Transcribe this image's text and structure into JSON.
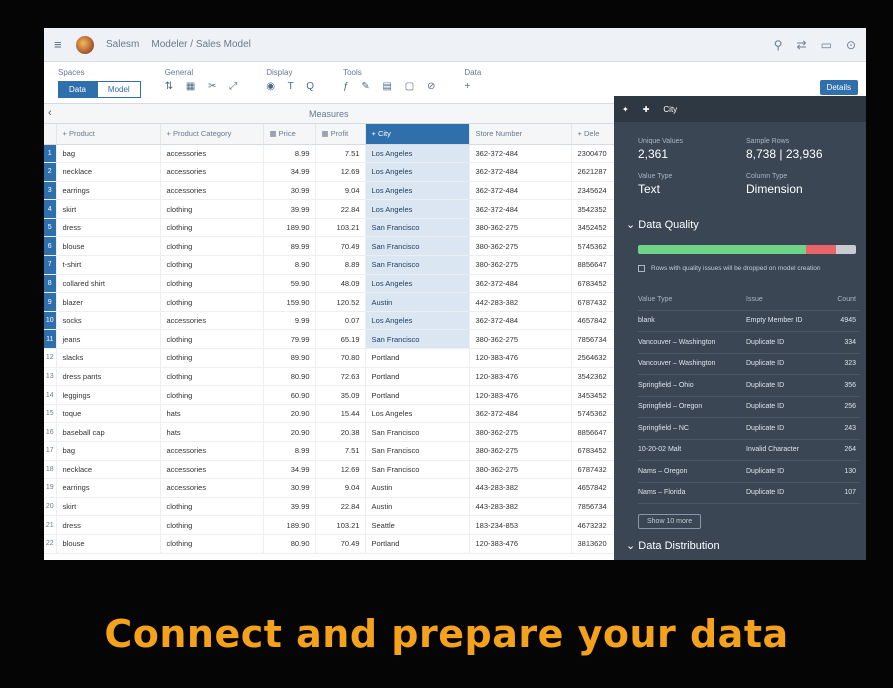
{
  "shell": {
    "menu_icon": "hamburger-icon",
    "app_name": "Salesm",
    "breadcrumb": "Modeler / Sales Model",
    "icons": [
      "search-icon",
      "share-icon",
      "chat-icon",
      "help-icon"
    ]
  },
  "toolbar": {
    "groups": [
      {
        "label": "Spaces",
        "items": [
          "Data",
          "Model"
        ]
      },
      {
        "label": "General",
        "icons": "⇅ ▦ ✂ ⤢"
      },
      {
        "label": "Display",
        "icons": "◉ T Q"
      },
      {
        "label": "Tools",
        "icons": "ƒ ✎ ▤ ▢ ⊘"
      },
      {
        "label": "Data",
        "icons": "+"
      }
    ],
    "details_label": "Details"
  },
  "measures_label": "Measures",
  "grid": {
    "columns": [
      "+ Product",
      "+ Product Category",
      "▦ Price",
      "▦ Profit",
      "+ City",
      "Store Number",
      "+ Dele"
    ],
    "rows": [
      {
        "i": "1",
        "c": [
          "bag",
          "accessories",
          "8.99",
          "7.51",
          "Los Angeles",
          "362-372-484",
          "2300470"
        ]
      },
      {
        "i": "2",
        "c": [
          "necklace",
          "accessories",
          "34.99",
          "12.69",
          "Los Angeles",
          "362-372-484",
          "2621287"
        ]
      },
      {
        "i": "3",
        "c": [
          "earrings",
          "accessories",
          "30.99",
          "9.04",
          "Los Angeles",
          "362-372-484",
          "2345624"
        ]
      },
      {
        "i": "4",
        "c": [
          "skirt",
          "clothing",
          "39.99",
          "22.84",
          "Los Angeles",
          "362-372-484",
          "3542352"
        ]
      },
      {
        "i": "5",
        "c": [
          "dress",
          "clothing",
          "189.90",
          "103.21",
          "San Francisco",
          "380-362-275",
          "3452452"
        ]
      },
      {
        "i": "6",
        "c": [
          "blouse",
          "clothing",
          "89.99",
          "70.49",
          "San Francisco",
          "380-362-275",
          "5745362"
        ]
      },
      {
        "i": "7",
        "c": [
          "t-shirt",
          "clothing",
          "8.90",
          "8.89",
          "San Francisco",
          "380-362-275",
          "8856647"
        ]
      },
      {
        "i": "8",
        "c": [
          "collared shirt",
          "clothing",
          "59.90",
          "48.09",
          "Los Angeles",
          "362-372-484",
          "6783452"
        ]
      },
      {
        "i": "9",
        "c": [
          "blazer",
          "clothing",
          "159.90",
          "120.52",
          "Austin",
          "442-283-382",
          "6787432"
        ]
      },
      {
        "i": "10",
        "c": [
          "socks",
          "accessories",
          "9.99",
          "0.07",
          "Los Angeles",
          "362-372-484",
          "4657842"
        ]
      },
      {
        "i": "11",
        "c": [
          "jeans",
          "clothing",
          "79.99",
          "65.19",
          "San Francisco",
          "380-362-275",
          "7856734"
        ]
      },
      {
        "i": "12",
        "c": [
          "slacks",
          "clothing",
          "89.90",
          "70.80",
          "Portland",
          "120-383-476",
          "2564632"
        ]
      },
      {
        "i": "13",
        "c": [
          "dress pants",
          "clothing",
          "80.90",
          "72.63",
          "Portland",
          "120-383-476",
          "3542362"
        ]
      },
      {
        "i": "14",
        "c": [
          "leggings",
          "clothing",
          "60.90",
          "35.09",
          "Portland",
          "120-383-476",
          "3453452"
        ]
      },
      {
        "i": "15",
        "c": [
          "toque",
          "hats",
          "20.90",
          "15.44",
          "Los Angeles",
          "362-372-484",
          "5745362"
        ]
      },
      {
        "i": "16",
        "c": [
          "baseball cap",
          "hats",
          "20.90",
          "20.38",
          "San Francisco",
          "380-362-275",
          "8856647"
        ]
      },
      {
        "i": "17",
        "c": [
          "bag",
          "accessories",
          "8.99",
          "7.51",
          "San Francisco",
          "380-362-275",
          "6783452"
        ]
      },
      {
        "i": "18",
        "c": [
          "necklace",
          "accessories",
          "34.99",
          "12.69",
          "San Francisco",
          "380-362-275",
          "6787432"
        ]
      },
      {
        "i": "19",
        "c": [
          "earrings",
          "accessories",
          "30.99",
          "9.04",
          "Austin",
          "443-283-382",
          "4657842"
        ]
      },
      {
        "i": "20",
        "c": [
          "skirt",
          "clothing",
          "39.99",
          "22.84",
          "Austin",
          "443-283-382",
          "7856734"
        ]
      },
      {
        "i": "21",
        "c": [
          "dress",
          "clothing",
          "189.90",
          "103.21",
          "Seattle",
          "183-234-853",
          "4673232"
        ]
      },
      {
        "i": "22",
        "c": [
          "blouse",
          "clothing",
          "80.90",
          "70.49",
          "Portland",
          "120-383-476",
          "3813620"
        ]
      }
    ]
  },
  "panel": {
    "title": "City",
    "stats": [
      {
        "k": "Unique Values",
        "v": "2,361"
      },
      {
        "k": "Sample Rows",
        "v": "8,738 | 23,936"
      },
      {
        "k": "Value Type",
        "v": "Text"
      },
      {
        "k": "Column Type",
        "v": "Dimension"
      }
    ],
    "quality_title": "Data Quality",
    "quality_bar": {
      "good": 0.77,
      "bad": 0.14,
      "other": 0.09,
      "colors": {
        "good": "#6fd38a",
        "bad": "#e9636b",
        "other": "#c8ccd1"
      }
    },
    "note": "Rows with quality issues will be dropped on model creation",
    "table_header": [
      "Value Type",
      "Issue",
      "Count"
    ],
    "table_rows": [
      [
        "blank",
        "Empty Member ID",
        "4945"
      ],
      [
        "Vancouver – Washington",
        "Duplicate ID",
        "334"
      ],
      [
        "Vancouver – Washington",
        "Duplicate ID",
        "323"
      ],
      [
        "Springfield – Ohio",
        "Duplicate ID",
        "356"
      ],
      [
        "Springfield – Oregon",
        "Duplicate ID",
        "256"
      ],
      [
        "Springfield – NC",
        "Duplicate ID",
        "243"
      ],
      [
        "10-20-02 Malt",
        "Invalid Character",
        "264"
      ],
      [
        "Nams – Oregon",
        "Duplicate ID",
        "130"
      ],
      [
        "Nams – Florida",
        "Duplicate ID",
        "107"
      ]
    ],
    "show_more": "Show 10 more",
    "distribution_title": "Data Distribution"
  },
  "headline": "Connect and prepare your data"
}
